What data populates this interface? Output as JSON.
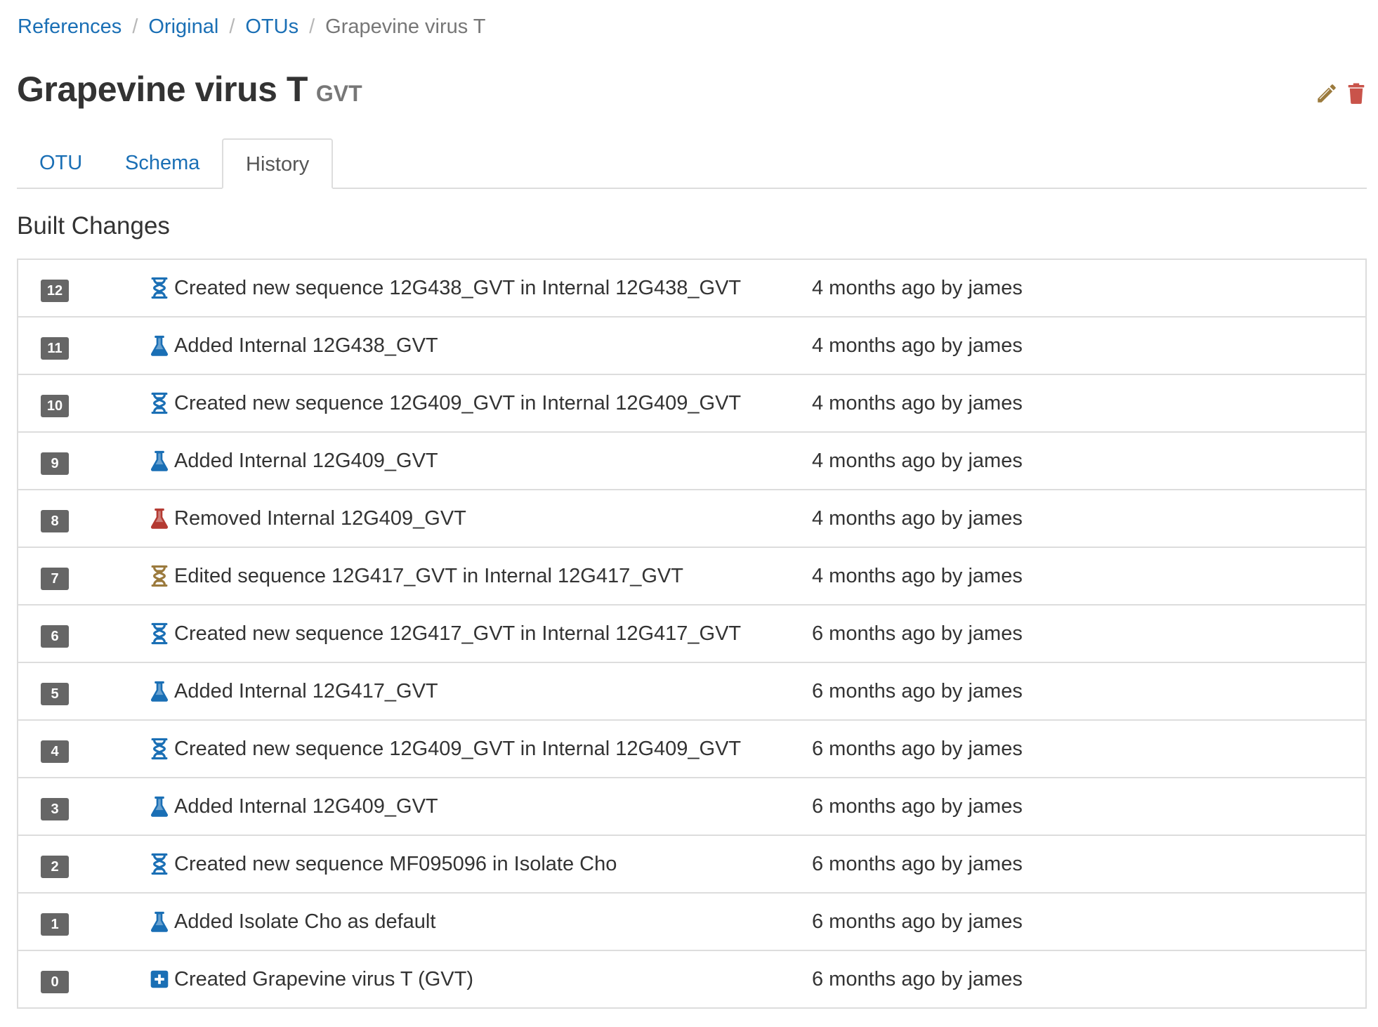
{
  "breadcrumb": {
    "items": [
      "References",
      "Original",
      "OTUs"
    ],
    "separator": "/",
    "current": "Grapevine virus T"
  },
  "otu": {
    "name": "Grapevine virus T",
    "abbreviation": "GVT"
  },
  "actions": {
    "edit_icon": "pencil-icon",
    "delete_icon": "trash-icon"
  },
  "tabs": [
    {
      "label": "OTU",
      "active": false
    },
    {
      "label": "Schema",
      "active": false
    },
    {
      "label": "History",
      "active": true
    }
  ],
  "section": {
    "title": "Built Changes"
  },
  "colors": {
    "link": "#1a6fb5",
    "sequence_created": "#1a6fb5",
    "isolate_added": "#1a6fb5",
    "isolate_removed": "#b43a32",
    "sequence_edited": "#9b7a3d",
    "edit_icon": "#9b7a3d",
    "delete_icon": "#c9534a",
    "badge": "#666666"
  },
  "changes": [
    {
      "version": "12",
      "icon": "dna-icon",
      "kind": "sequence_created",
      "description": "Created new sequence 12G438_GVT in Internal 12G438_GVT",
      "time": "4 months ago by james"
    },
    {
      "version": "11",
      "icon": "flask-icon",
      "kind": "isolate_added",
      "description": "Added Internal 12G438_GVT",
      "time": "4 months ago by james"
    },
    {
      "version": "10",
      "icon": "dna-icon",
      "kind": "sequence_created",
      "description": "Created new sequence 12G409_GVT in Internal 12G409_GVT",
      "time": "4 months ago by james"
    },
    {
      "version": "9",
      "icon": "flask-icon",
      "kind": "isolate_added",
      "description": "Added Internal 12G409_GVT",
      "time": "4 months ago by james"
    },
    {
      "version": "8",
      "icon": "flask-icon",
      "kind": "isolate_removed",
      "description": "Removed Internal 12G409_GVT",
      "time": "4 months ago by james"
    },
    {
      "version": "7",
      "icon": "dna-icon",
      "kind": "sequence_edited",
      "description": "Edited sequence 12G417_GVT in Internal 12G417_GVT",
      "time": "4 months ago by james"
    },
    {
      "version": "6",
      "icon": "dna-icon",
      "kind": "sequence_created",
      "description": "Created new sequence 12G417_GVT in Internal 12G417_GVT",
      "time": "6 months ago by james"
    },
    {
      "version": "5",
      "icon": "flask-icon",
      "kind": "isolate_added",
      "description": "Added Internal 12G417_GVT",
      "time": "6 months ago by james"
    },
    {
      "version": "4",
      "icon": "dna-icon",
      "kind": "sequence_created",
      "description": "Created new sequence 12G409_GVT in Internal 12G409_GVT",
      "time": "6 months ago by james"
    },
    {
      "version": "3",
      "icon": "flask-icon",
      "kind": "isolate_added",
      "description": "Added Internal 12G409_GVT",
      "time": "6 months ago by james"
    },
    {
      "version": "2",
      "icon": "dna-icon",
      "kind": "sequence_created",
      "description": "Created new sequence MF095096 in Isolate Cho",
      "time": "6 months ago by james"
    },
    {
      "version": "1",
      "icon": "flask-icon",
      "kind": "isolate_added",
      "description": "Added Isolate Cho as default",
      "time": "6 months ago by james"
    },
    {
      "version": "0",
      "icon": "plus-square-icon",
      "kind": "otu_created",
      "description": "Created Grapevine virus T (GVT)",
      "time": "6 months ago by james"
    }
  ]
}
